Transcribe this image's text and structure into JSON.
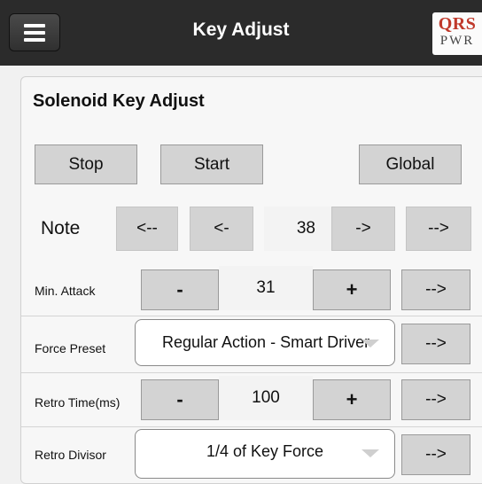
{
  "header": {
    "title": "Key Adjust",
    "logo_top": "QRS",
    "logo_bottom": "PWR"
  },
  "panel": {
    "title": "Solenoid Key Adjust"
  },
  "controls": {
    "stop": "Stop",
    "start": "Start",
    "global": "Global"
  },
  "note": {
    "label": "Note",
    "back_far": "<--",
    "back": "<-",
    "value": "38",
    "fwd": "->",
    "fwd_far": "-->"
  },
  "min_attack": {
    "label": "Min. Attack",
    "minus": "-",
    "value": "31",
    "plus": "+",
    "apply": "-->"
  },
  "force_preset": {
    "label": "Force Preset",
    "selected": "Regular Action - Smart Driver",
    "apply": "-->"
  },
  "retro_time": {
    "label": "Retro Time(ms)",
    "minus": "-",
    "value": "100",
    "plus": "+",
    "apply": "-->"
  },
  "retro_divisor": {
    "label": "Retro Divisor",
    "selected": "1/4 of Key Force",
    "apply": "-->"
  }
}
